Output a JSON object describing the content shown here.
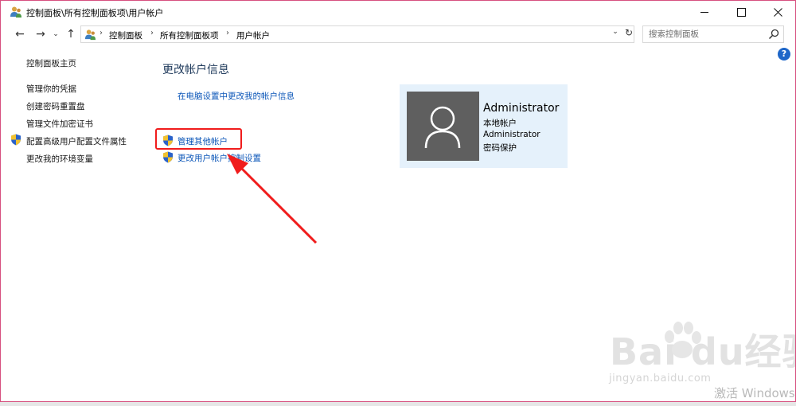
{
  "window": {
    "title": "控制面板\\所有控制面板项\\用户帐户"
  },
  "nav": {
    "back": "←",
    "forward": "→",
    "recent": "⌄",
    "up": "↑",
    "breadcrumbs": [
      "控制面板",
      "所有控制面板项",
      "用户帐户"
    ],
    "search_placeholder": "搜索控制面板"
  },
  "help": "?",
  "sidebar": {
    "items": [
      {
        "label": "控制面板主页"
      },
      {
        "label": "管理你的凭据"
      },
      {
        "label": "创建密码重置盘"
      },
      {
        "label": "管理文件加密证书"
      },
      {
        "label": "配置高级用户配置文件属性"
      },
      {
        "label": "更改我的环境变量"
      }
    ]
  },
  "main": {
    "heading": "更改帐户信息",
    "links": [
      {
        "label": "在电脑设置中更改我的帐户信息"
      },
      {
        "label": "管理其他帐户"
      },
      {
        "label": "更改用户帐户控制设置"
      }
    ]
  },
  "user": {
    "name": "Administrator",
    "type": "本地帐户",
    "group": "Administrator",
    "password": "密码保护"
  },
  "watermark": {
    "brand": "Bai du经验",
    "url": "jingyan.baidu.com",
    "activate": "激活 Windows"
  },
  "colors": {
    "link": "#0a55b8",
    "heading": "#1e395b",
    "annotation_red": "#f01c1c",
    "card_bg": "#e5f1fb",
    "avatar_bg": "#5f5f5f"
  }
}
